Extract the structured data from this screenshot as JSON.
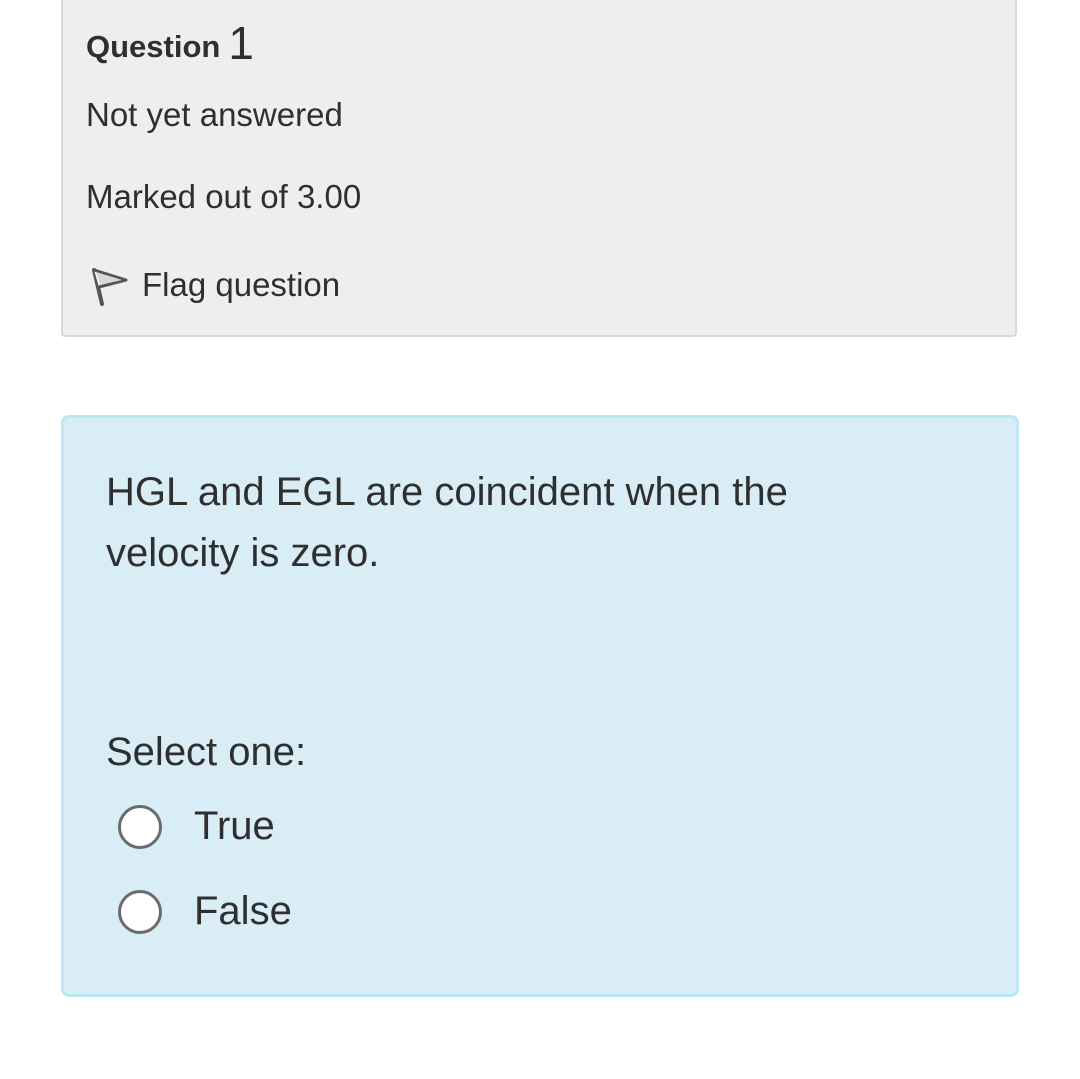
{
  "question_info": {
    "label": "Question",
    "number": "1",
    "state": "Not yet answered",
    "grade": "Marked out of 3.00",
    "flag_label": "Flag question",
    "flag_icon": "flag-icon"
  },
  "formulation": {
    "question_text": "HGL and EGL are coincident when the velocity is zero.",
    "prompt": "Select one:",
    "options": [
      {
        "label": "True",
        "selected": false
      },
      {
        "label": "False",
        "selected": false
      }
    ]
  },
  "colors": {
    "info_background": "#eeeeee",
    "info_border": "#d9d9d9",
    "formulation_background": "#d9edf7",
    "formulation_border": "#bce8f1",
    "text": "#2f2f2f"
  }
}
